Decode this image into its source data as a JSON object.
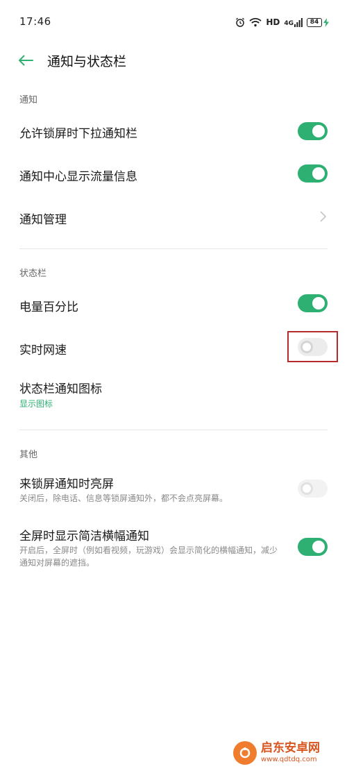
{
  "status_bar": {
    "time": "17:46",
    "hd": "HD",
    "net": "4G",
    "battery": "84"
  },
  "header": {
    "title": "通知与状态栏"
  },
  "sections": {
    "notify": {
      "label": "通知",
      "lockscreen_pulldown": {
        "title": "允许锁屏时下拉通知栏",
        "enabled": true
      },
      "traffic_info": {
        "title": "通知中心显示流量信息",
        "enabled": true
      },
      "manage": {
        "title": "通知管理"
      }
    },
    "statusbar": {
      "label": "状态栏",
      "battery_percent": {
        "title": "电量百分比",
        "enabled": true
      },
      "realtime_speed": {
        "title": "实时网速",
        "enabled": false
      },
      "notify_icons": {
        "title": "状态栏通知图标",
        "value": "显示图标"
      }
    },
    "other": {
      "label": "其他",
      "wake_on_notify": {
        "title": "来锁屏通知时亮屏",
        "subtitle": "关闭后，除电话、信息等锁屏通知外，都不会点亮屏幕。",
        "enabled": false
      },
      "fullscreen_banner": {
        "title": "全屏时显示简洁横幅通知",
        "subtitle": "开启后，全屏时（例如看视频，玩游戏）会显示简化的横幅通知，减少通知对屏幕的遮挡。",
        "enabled": true
      }
    }
  },
  "watermark": {
    "name": "启东安卓网",
    "url": "www.qdtdq.com"
  },
  "colors": {
    "accent": "#2eb072",
    "highlight": "#b52a2a"
  }
}
